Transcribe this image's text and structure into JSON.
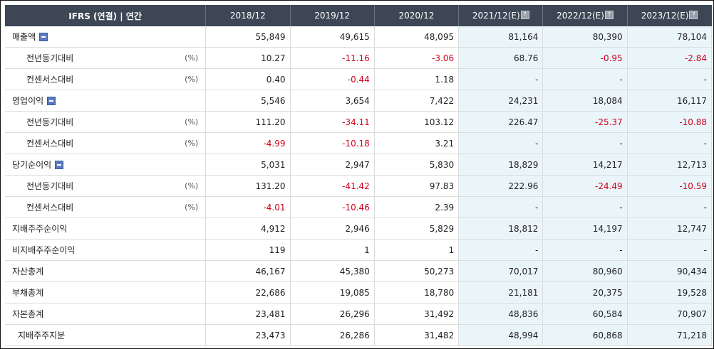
{
  "header": {
    "title": "IFRS (연결) | 연간",
    "periods": [
      "2018/12",
      "2019/12",
      "2020/12",
      "2021/12(E)",
      "2022/12(E)",
      "2023/12(E)"
    ],
    "help_flags": [
      false,
      false,
      false,
      true,
      true,
      true
    ],
    "help_glyph": "?"
  },
  "rows": [
    {
      "label": "매출액",
      "unit": "",
      "level": 0,
      "toggle": true,
      "values": [
        "55,849",
        "49,615",
        "48,095",
        "81,164",
        "80,390",
        "78,104"
      ]
    },
    {
      "label": "전년동기대비",
      "unit": "(%)",
      "level": 1,
      "toggle": false,
      "values": [
        "10.27",
        "-11.16",
        "-3.06",
        "68.76",
        "-0.95",
        "-2.84"
      ]
    },
    {
      "label": "컨센서스대비",
      "unit": "(%)",
      "level": 1,
      "toggle": false,
      "values": [
        "0.40",
        "-0.44",
        "1.18",
        "-",
        "-",
        "-"
      ]
    },
    {
      "label": "영업이익",
      "unit": "",
      "level": 0,
      "toggle": true,
      "values": [
        "5,546",
        "3,654",
        "7,422",
        "24,231",
        "18,084",
        "16,117"
      ]
    },
    {
      "label": "전년동기대비",
      "unit": "(%)",
      "level": 1,
      "toggle": false,
      "values": [
        "111.20",
        "-34.11",
        "103.12",
        "226.47",
        "-25.37",
        "-10.88"
      ]
    },
    {
      "label": "컨센서스대비",
      "unit": "(%)",
      "level": 1,
      "toggle": false,
      "values": [
        "-4.99",
        "-10.18",
        "3.21",
        "-",
        "-",
        "-"
      ]
    },
    {
      "label": "당기순이익",
      "unit": "",
      "level": 0,
      "toggle": true,
      "values": [
        "5,031",
        "2,947",
        "5,830",
        "18,829",
        "14,217",
        "12,713"
      ]
    },
    {
      "label": "전년동기대비",
      "unit": "(%)",
      "level": 1,
      "toggle": false,
      "values": [
        "131.20",
        "-41.42",
        "97.83",
        "222.96",
        "-24.49",
        "-10.59"
      ]
    },
    {
      "label": "컨센서스대비",
      "unit": "(%)",
      "level": 1,
      "toggle": false,
      "values": [
        "-4.01",
        "-10.46",
        "2.39",
        "-",
        "-",
        "-"
      ]
    },
    {
      "label": "지배주주순이익",
      "unit": "",
      "level": 0,
      "toggle": false,
      "values": [
        "4,912",
        "2,946",
        "5,829",
        "18,812",
        "14,197",
        "12,747"
      ]
    },
    {
      "label": "비지배주주순이익",
      "unit": "",
      "level": 0,
      "toggle": false,
      "values": [
        "119",
        "1",
        "1",
        "-",
        "-",
        "-"
      ]
    },
    {
      "label": "자산총계",
      "unit": "",
      "level": 0,
      "toggle": false,
      "values": [
        "46,167",
        "45,380",
        "50,273",
        "70,017",
        "80,960",
        "90,434"
      ]
    },
    {
      "label": "부채총계",
      "unit": "",
      "level": 0,
      "toggle": false,
      "values": [
        "22,686",
        "19,085",
        "18,780",
        "21,181",
        "20,375",
        "19,528"
      ]
    },
    {
      "label": "자본총계",
      "unit": "",
      "level": 0,
      "toggle": false,
      "values": [
        "23,481",
        "26,296",
        "31,492",
        "48,836",
        "60,584",
        "70,907"
      ]
    },
    {
      "label": "지배주주지분",
      "unit": "",
      "level": 2,
      "toggle": false,
      "values": [
        "23,473",
        "26,286",
        "31,482",
        "48,994",
        "60,868",
        "71,218"
      ]
    }
  ],
  "colors": {
    "header_bg": "#3d4654",
    "estimate_bg": "#eaf5fa",
    "negative": "#d0021b",
    "toggle": "#5b7bc0"
  },
  "estimate_columns": [
    3,
    4,
    5
  ]
}
